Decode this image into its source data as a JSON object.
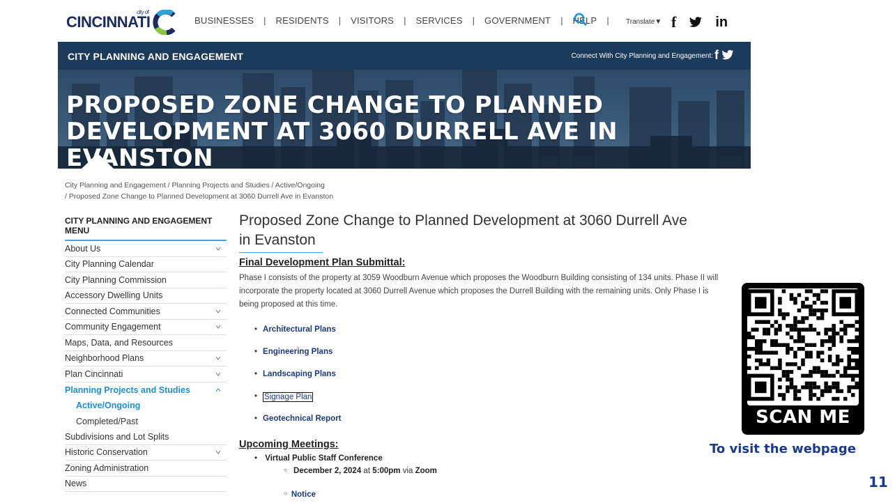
{
  "header": {
    "logo_small": "city of",
    "logo_text": "CINCINNATI",
    "nav": [
      "BUSINESSES",
      "RESIDENTS",
      "VISITORS",
      "SERVICES",
      "GOVERNMENT",
      "HELP"
    ],
    "translate_label": "Translate▼",
    "social": [
      "f",
      "in"
    ]
  },
  "dept": {
    "title": "CITY PLANNING AND ENGAGEMENT",
    "connect": "Connect With City Planning and Engagement:"
  },
  "hero": {
    "title_line1": "PROPOSED ZONE CHANGE TO PLANNED",
    "title_line2": "DEVELOPMENT AT 3060 DURRELL AVE IN EVANSTON"
  },
  "breadcrumb": {
    "line1": "City Planning and Engagement   / Planning Projects and Studies   / Active/Ongoing",
    "line2": "/ Proposed Zone Change to Planned Development at 3060 Durrell Ave in Evanston"
  },
  "menu": {
    "heading_line1": "CITY PLANNING AND ENGAGEMENT",
    "heading_line2": "MENU",
    "items": [
      {
        "label": "About Us",
        "chevron": "down"
      },
      {
        "label": "City Planning Calendar",
        "chevron": ""
      },
      {
        "label": "City Planning Commission",
        "chevron": ""
      },
      {
        "label": "Accessory Dwelling Units",
        "chevron": ""
      },
      {
        "label": "Connected Communities",
        "chevron": "down"
      },
      {
        "label": "Community Engagement",
        "chevron": "down"
      },
      {
        "label": "Maps, Data, and Resources",
        "chevron": ""
      },
      {
        "label": "Neighborhood Plans",
        "chevron": "down"
      },
      {
        "label": "Plan Cincinnati",
        "chevron": "down"
      },
      {
        "label": "Planning Projects and Studies",
        "chevron": "up",
        "active": true
      },
      {
        "label": "Active/Ongoing",
        "sub": true,
        "active": true
      },
      {
        "label": "Completed/Past",
        "sub": true
      },
      {
        "label": "Subdivisions and Lot Splits",
        "chevron": ""
      },
      {
        "label": "Historic Conservation",
        "chevron": "down"
      },
      {
        "label": "Zoning Administration",
        "chevron": ""
      },
      {
        "label": "News",
        "chevron": ""
      }
    ]
  },
  "main": {
    "title_line1": "Proposed Zone Change to Planned Development at 3060 Durrell Ave",
    "title_line2": "in Evanston",
    "submittal_head": "Final Development Plan Submittal:",
    "paragraph": "Phase I consists of the property at 3059 Woodburn Avenue which proposes the Woodburn Building consisting of 134 units. Phase II will incorporate the property located at 3060 Durrell Avenue which proposes the Durrell Building with the remaining units. Only Phase I is being proposed at this time.",
    "links": [
      "Architectural Plans",
      "Engineering Plans",
      "Landscaping Plans",
      "Signage Plan",
      "Geotechnical Report"
    ],
    "meetings_head": "Upcoming Meetings:",
    "meeting_name": "Virtual Public Staff Conference",
    "meeting_date": "December 2, 2024",
    "meeting_at": " at ",
    "meeting_time": "5:00pm",
    "meeting_via": " via ",
    "meeting_platform": "Zoom",
    "notice": "Notice"
  },
  "qr": {
    "label": "SCAN ME",
    "caption": "To visit the webpage"
  },
  "slide_number": "11",
  "colors": {
    "navy": "#1b3a5c",
    "accent_blue": "#1e8fd6",
    "link_blue": "#1b3a7a"
  }
}
